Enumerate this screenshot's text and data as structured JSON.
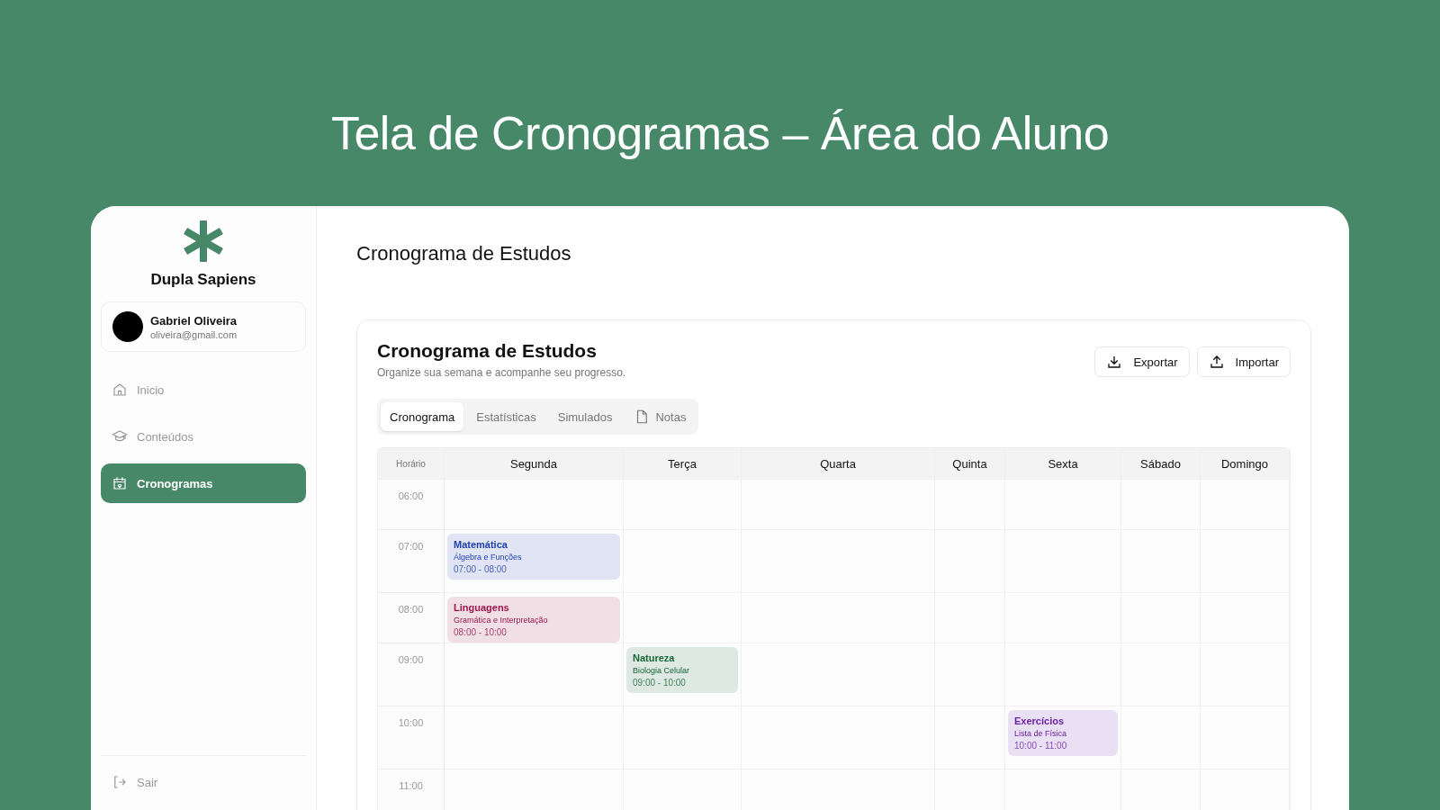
{
  "headline": "Tela de Cronogramas – Área do Aluno",
  "sidebar": {
    "brand": "Dupla Sapiens",
    "user": {
      "name": "Gabriel Oliveira",
      "email": "oliveira@gmail.com"
    },
    "items": [
      {
        "label": "Inicio",
        "selected": false
      },
      {
        "label": "Conteúdos",
        "selected": false
      },
      {
        "label": "Cronogramas",
        "selected": true
      }
    ],
    "logout": "Sair"
  },
  "page_title": "Cronograma de Estudos",
  "panel": {
    "title": "Cronograma de Estudos",
    "subtitle": "Organize sua semana e acompanhe seu progresso.",
    "actions": [
      {
        "label": "Exportar"
      },
      {
        "label": "Importar"
      }
    ],
    "tabs": [
      {
        "label": "Cronograma",
        "selected": true
      },
      {
        "label": "Estatísticas",
        "selected": false
      },
      {
        "label": "Simulados",
        "selected": false
      },
      {
        "label": "Notas",
        "selected": false
      }
    ]
  },
  "schedule": {
    "columns": [
      "Horário",
      "Segunda",
      "Terça",
      "Quarta",
      "Quinta",
      "Sexta",
      "Sábado",
      "Domingo"
    ],
    "rows": [
      {
        "cells": [
          "06:00",
          "",
          "",
          "",
          "",
          "",
          "",
          ""
        ]
      },
      {
        "cells": [
          "07:00",
          {
            "event": {
              "title": "Matemática",
              "topic": "Álgebra e Funções",
              "time": "07:00 - 08:00",
              "color": "#1e3fae"
            }
          },
          "",
          "",
          "",
          "",
          "",
          ""
        ]
      },
      {
        "cells": [
          "08:00",
          {
            "event": {
              "title": "Linguagens",
              "topic": "Gramática e Interpretação",
              "time": "08:00 - 10:00",
              "color": "#9d174d"
            }
          },
          "",
          "",
          "",
          "",
          "",
          ""
        ]
      },
      {
        "cells": [
          "09:00",
          "",
          {
            "event": {
              "title": "Natureza",
              "topic": "Biologia Celular",
              "time": "09:00 - 10:00",
              "color": "#166534"
            }
          },
          "",
          "",
          "",
          "",
          ""
        ]
      },
      {
        "cells": [
          "10:00",
          "",
          "",
          "",
          "",
          {
            "event": {
              "title": "Exercícios",
              "topic": "Lista de Física",
              "time": "10:00 - 11:00",
              "color": "#6b21a8"
            }
          },
          "",
          ""
        ]
      },
      {
        "cells": [
          "11:00",
          "",
          "",
          "",
          "",
          "",
          "",
          ""
        ]
      }
    ]
  }
}
